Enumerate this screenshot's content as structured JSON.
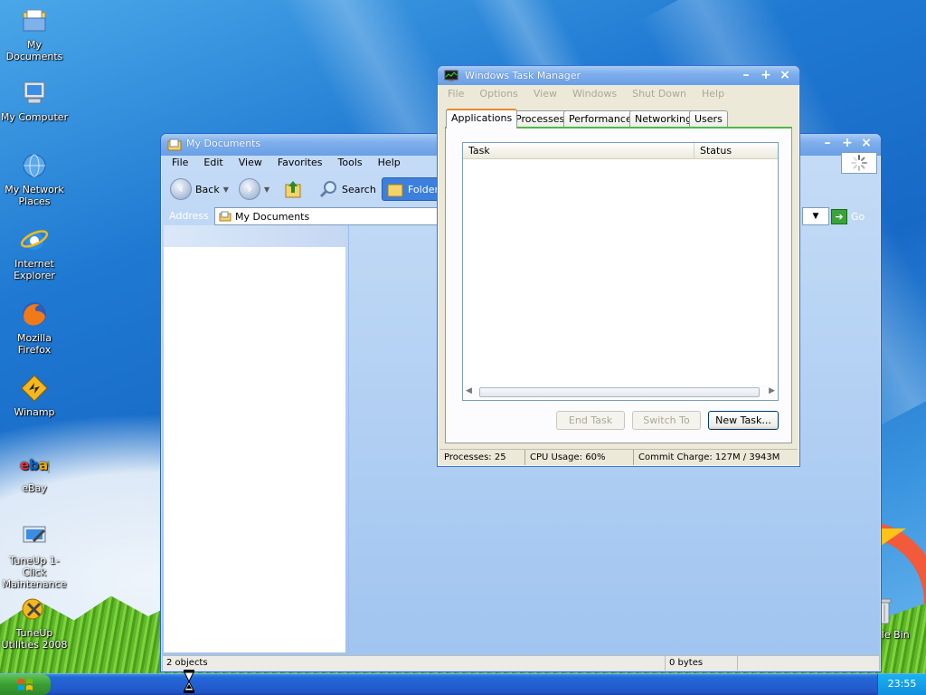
{
  "desktop": {
    "icons": [
      {
        "label": "My Documents",
        "icon": "folder-documents-icon"
      },
      {
        "label": "My Computer",
        "icon": "computer-icon"
      },
      {
        "label": "My Network Places",
        "icon": "network-globe-icon"
      },
      {
        "label": "Internet Explorer",
        "icon": "internet-explorer-icon"
      },
      {
        "label": "Mozilla Firefox",
        "icon": "firefox-icon"
      },
      {
        "label": "Winamp",
        "icon": "winamp-icon"
      },
      {
        "label": "eBay",
        "icon": "ebay-icon"
      },
      {
        "label": "TuneUp 1-Click Maintenance",
        "icon": "tuneup-maintenance-icon"
      },
      {
        "label": "TuneUp Utilities 2008",
        "icon": "tuneup-utilities-icon"
      },
      {
        "label": "Recycle Bin",
        "icon": "recycle-bin-icon"
      }
    ]
  },
  "explorer": {
    "title": "My Documents",
    "menu": [
      "File",
      "Edit",
      "View",
      "Favorites",
      "Tools",
      "Help"
    ],
    "toolbar": {
      "back": "Back",
      "search": "Search",
      "folders": "Folders"
    },
    "address_label": "Address",
    "address_value": "My Documents",
    "go": "Go",
    "status_objects": "2 objects",
    "status_size": "0 bytes"
  },
  "taskmgr": {
    "title": "Windows Task Manager",
    "menu": [
      "File",
      "Options",
      "View",
      "Windows",
      "Shut Down",
      "Help"
    ],
    "tabs": [
      "Applications",
      "Processes",
      "Performance",
      "Networking",
      "Users"
    ],
    "active_tab": "Applications",
    "columns": [
      "Task",
      "Status"
    ],
    "buttons": {
      "end_task": "End Task",
      "switch_to": "Switch To",
      "new_task": "New Task..."
    },
    "status": {
      "processes": "Processes: 25",
      "cpu": "CPU Usage: 60%",
      "commit": "Commit Charge: 127M / 3943M"
    }
  },
  "taskbar": {
    "clock": "23:55"
  },
  "colors": {
    "accent": "#2a64c8",
    "titlebar": "#7eaeec",
    "taskbar": "#2256c8",
    "start": "#3a9e32",
    "tray": "#118ee0"
  }
}
